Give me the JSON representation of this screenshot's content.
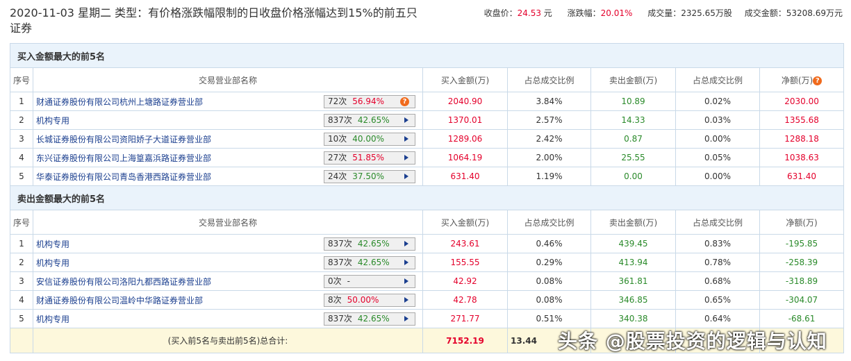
{
  "header": {
    "title": "2020-11-03 星期二  类型：有价格涨跌幅限制的日收盘价格涨幅达到15%的前五只证券"
  },
  "stats": {
    "close_label": "收盘价：",
    "close": "24.53",
    "close_unit": "元",
    "chg_label": "涨跌幅：",
    "chg": "20.01%",
    "vol_label": "成交量：",
    "vol": "2325.65万股",
    "amt_label": "成交金额：",
    "amt": "53208.69万元"
  },
  "columns": [
    "序号",
    "交易营业部名称",
    "买入金额(万)",
    "占总成交比例",
    "卖出金额(万)",
    "占总成交比例",
    "净额(万)"
  ],
  "buy": {
    "title": "买入金额最大的前5名",
    "rows": [
      {
        "no": "1",
        "name": "财通证券股份有限公司杭州上塘路证券营业部",
        "times": "72次",
        "pct": "56.94%",
        "pc": "red",
        "icon": "question",
        "buy": "2040.90",
        "br": "3.84%",
        "sell": "10.89",
        "sr": "0.02%",
        "net": "2030.00"
      },
      {
        "no": "2",
        "name": "机构专用",
        "times": "837次",
        "pct": "42.65%",
        "pc": "green",
        "icon": "arrow",
        "buy": "1370.01",
        "br": "2.57%",
        "sell": "14.33",
        "sr": "0.03%",
        "net": "1355.68"
      },
      {
        "no": "3",
        "name": "长城证券股份有限公司资阳娇子大道证券营业部",
        "times": "10次",
        "pct": "40.00%",
        "pc": "green",
        "icon": "arrow",
        "buy": "1289.06",
        "br": "2.42%",
        "sell": "0.87",
        "sr": "0.00%",
        "net": "1288.18"
      },
      {
        "no": "4",
        "name": "东兴证券股份有限公司上海篁嘉浜路证券营业部",
        "times": "27次",
        "pct": "51.85%",
        "pc": "red",
        "icon": "arrow",
        "buy": "1064.19",
        "br": "2.00%",
        "sell": "25.55",
        "sr": "0.05%",
        "net": "1038.63"
      },
      {
        "no": "5",
        "name": "华泰证券股份有限公司青岛香港西路证券营业部",
        "times": "24次",
        "pct": "37.50%",
        "pc": "green",
        "icon": "arrow",
        "buy": "631.40",
        "br": "1.19%",
        "sell": "0.00",
        "sr": "0.00%",
        "net": "631.40"
      }
    ]
  },
  "sell": {
    "title": "卖出金额最大的前5名",
    "rows": [
      {
        "no": "1",
        "name": "机构专用",
        "times": "837次",
        "pct": "42.65%",
        "pc": "green",
        "icon": "arrow",
        "buy": "243.61",
        "br": "0.46%",
        "sell": "439.45",
        "sr": "0.83%",
        "net": "-195.85"
      },
      {
        "no": "2",
        "name": "机构专用",
        "times": "837次",
        "pct": "42.65%",
        "pc": "green",
        "icon": "arrow",
        "buy": "155.55",
        "br": "0.29%",
        "sell": "413.94",
        "sr": "0.78%",
        "net": "-258.39"
      },
      {
        "no": "3",
        "name": "安信证券股份有限公司洛阳九都西路证券营业部",
        "times": "0次",
        "pct": "-",
        "pc": "plain",
        "icon": "arrow",
        "buy": "42.92",
        "br": "0.08%",
        "sell": "361.81",
        "sr": "0.68%",
        "net": "-318.89"
      },
      {
        "no": "4",
        "name": "财通证券股份有限公司温岭中华路证券营业部",
        "times": "8次",
        "pct": "50.00%",
        "pc": "red",
        "icon": "arrow",
        "buy": "42.78",
        "br": "0.08%",
        "sell": "346.85",
        "sr": "0.65%",
        "net": "-304.07"
      },
      {
        "no": "5",
        "name": "机构专用",
        "times": "837次",
        "pct": "42.65%",
        "pc": "green",
        "icon": "arrow",
        "buy": "271.77",
        "br": "0.51%",
        "sell": "340.38",
        "sr": "0.64%",
        "net": "-68.61"
      }
    ]
  },
  "total": {
    "label": "(买入前5名与卖出前5名)总合计:",
    "buy": "7152.19",
    "br": "13.44"
  },
  "watermark": "头条 @股票投资的逻辑与认知",
  "colors": {
    "red": "#e4002b",
    "green": "#2a8a2a",
    "link": "#1b3f8f"
  }
}
